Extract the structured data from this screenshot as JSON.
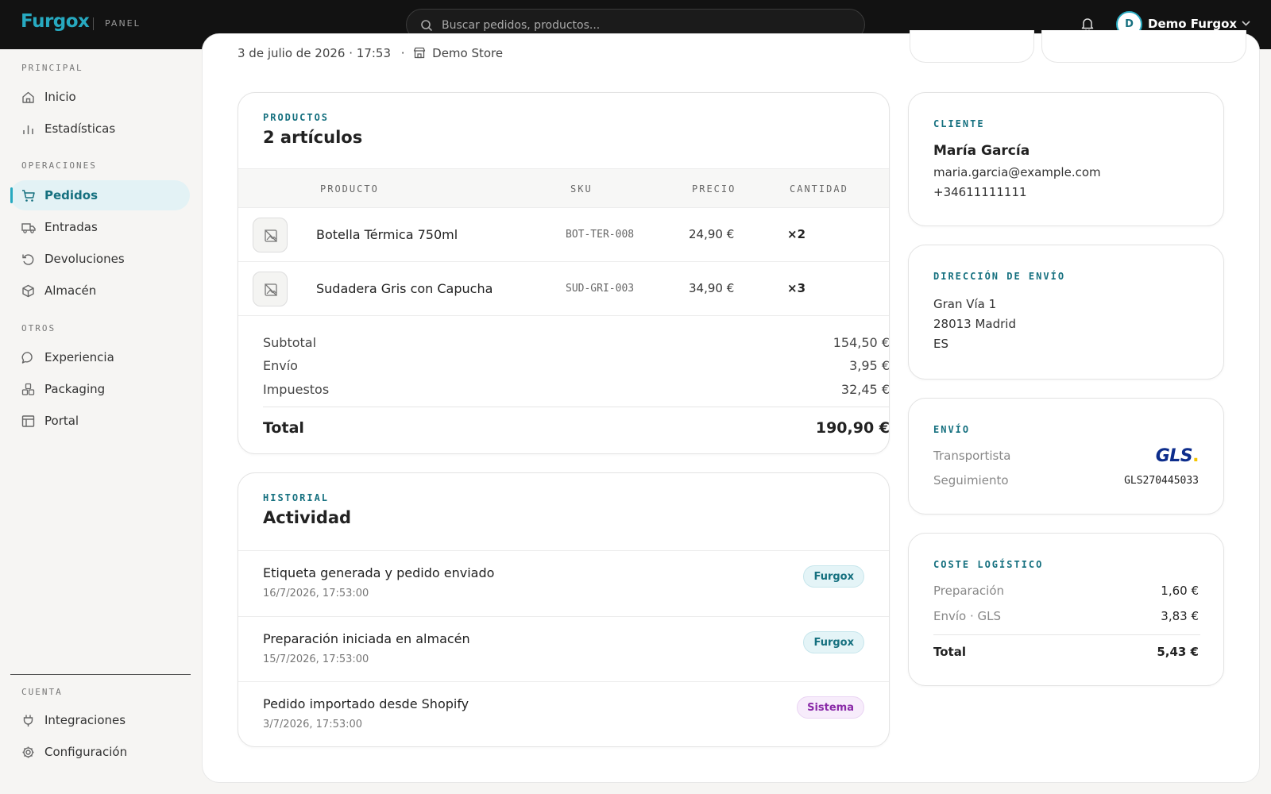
{
  "brand": {
    "name": "Furgox",
    "tag": "PANEL"
  },
  "search": {
    "placeholder": "Buscar pedidos, productos..."
  },
  "user": {
    "initial": "D",
    "name": "Demo Furgox"
  },
  "sidebar": {
    "sections": [
      {
        "label": "PRINCIPAL",
        "items": [
          {
            "label": "Inicio",
            "icon": "home-icon"
          },
          {
            "label": "Estadísticas",
            "icon": "bar-chart-icon"
          }
        ]
      },
      {
        "label": "OPERACIONES",
        "items": [
          {
            "label": "Pedidos",
            "icon": "cart-icon",
            "active": true
          },
          {
            "label": "Entradas",
            "icon": "truck-icon"
          },
          {
            "label": "Devoluciones",
            "icon": "return-icon"
          },
          {
            "label": "Almacén",
            "icon": "box-icon"
          }
        ]
      },
      {
        "label": "OTROS",
        "items": [
          {
            "label": "Experiencia",
            "icon": "chat-icon"
          },
          {
            "label": "Packaging",
            "icon": "packages-icon"
          },
          {
            "label": "Portal",
            "icon": "layout-icon"
          }
        ]
      },
      {
        "label": "CUENTA",
        "items": [
          {
            "label": "Integraciones",
            "icon": "plug-icon"
          },
          {
            "label": "Configuración",
            "icon": "gear-icon"
          }
        ]
      }
    ]
  },
  "order": {
    "date": "3 de julio de 2026 · 17:53",
    "separator": "·",
    "store": "Demo Store"
  },
  "products": {
    "eyebrow": "PRODUCTOS",
    "title": "2 artículos",
    "columns": [
      "PRODUCTO",
      "SKU",
      "PRECIO",
      "CANTIDAD"
    ],
    "rows": [
      {
        "name": "Botella Térmica 750ml",
        "sku": "BOT-TER-008",
        "price": "24,90 €",
        "qty": "×2"
      },
      {
        "name": "Sudadera Gris con Capucha",
        "sku": "SUD-GRI-003",
        "price": "34,90 €",
        "qty": "×3"
      }
    ],
    "summary": [
      {
        "label": "Subtotal",
        "value": "154,50 €"
      },
      {
        "label": "Envío",
        "value": "3,95 €"
      },
      {
        "label": "Impuestos",
        "value": "32,45 €"
      }
    ],
    "total": {
      "label": "Total",
      "value": "190,90 €"
    }
  },
  "history": {
    "eyebrow": "HISTORIAL",
    "title": "Actividad",
    "events": [
      {
        "title": "Etiqueta generada y pedido enviado",
        "time": "16/7/2026, 17:53:00",
        "badge": "Furgox",
        "badge_type": "furgox"
      },
      {
        "title": "Preparación iniciada en almacén",
        "time": "15/7/2026, 17:53:00",
        "badge": "Furgox",
        "badge_type": "furgox"
      },
      {
        "title": "Pedido importado desde Shopify",
        "time": "3/7/2026, 17:53:00",
        "badge": "Sistema",
        "badge_type": "sistema"
      }
    ]
  },
  "customer": {
    "eyebrow": "CLIENTE",
    "name": "María García",
    "email": "maria.garcia@example.com",
    "phone": "+34611111111"
  },
  "address": {
    "eyebrow": "DIRECCIÓN DE ENVÍO",
    "line1": "Gran Vía 1",
    "line2": "28013 Madrid",
    "country": "ES"
  },
  "shipping": {
    "eyebrow": "ENVÍO",
    "carrier_label": "Transportista",
    "carrier_logo": "GLS",
    "tracking_label": "Seguimiento",
    "tracking": "GLS270445033"
  },
  "logistics": {
    "eyebrow": "COSTE LOGÍSTICO",
    "rows": [
      {
        "label": "Preparación",
        "value": "1,60 €"
      },
      {
        "label": "Envío · GLS",
        "value": "3,83 €"
      }
    ],
    "total": {
      "label": "Total",
      "value": "5,43 €"
    }
  },
  "colors": {
    "accent": "#27a9c0",
    "accent_dark": "#15707f",
    "topbar": "#121212",
    "sistema": "#8a2aa8",
    "gls_blue": "#0d2d8c",
    "gls_yellow": "#f4c400"
  }
}
